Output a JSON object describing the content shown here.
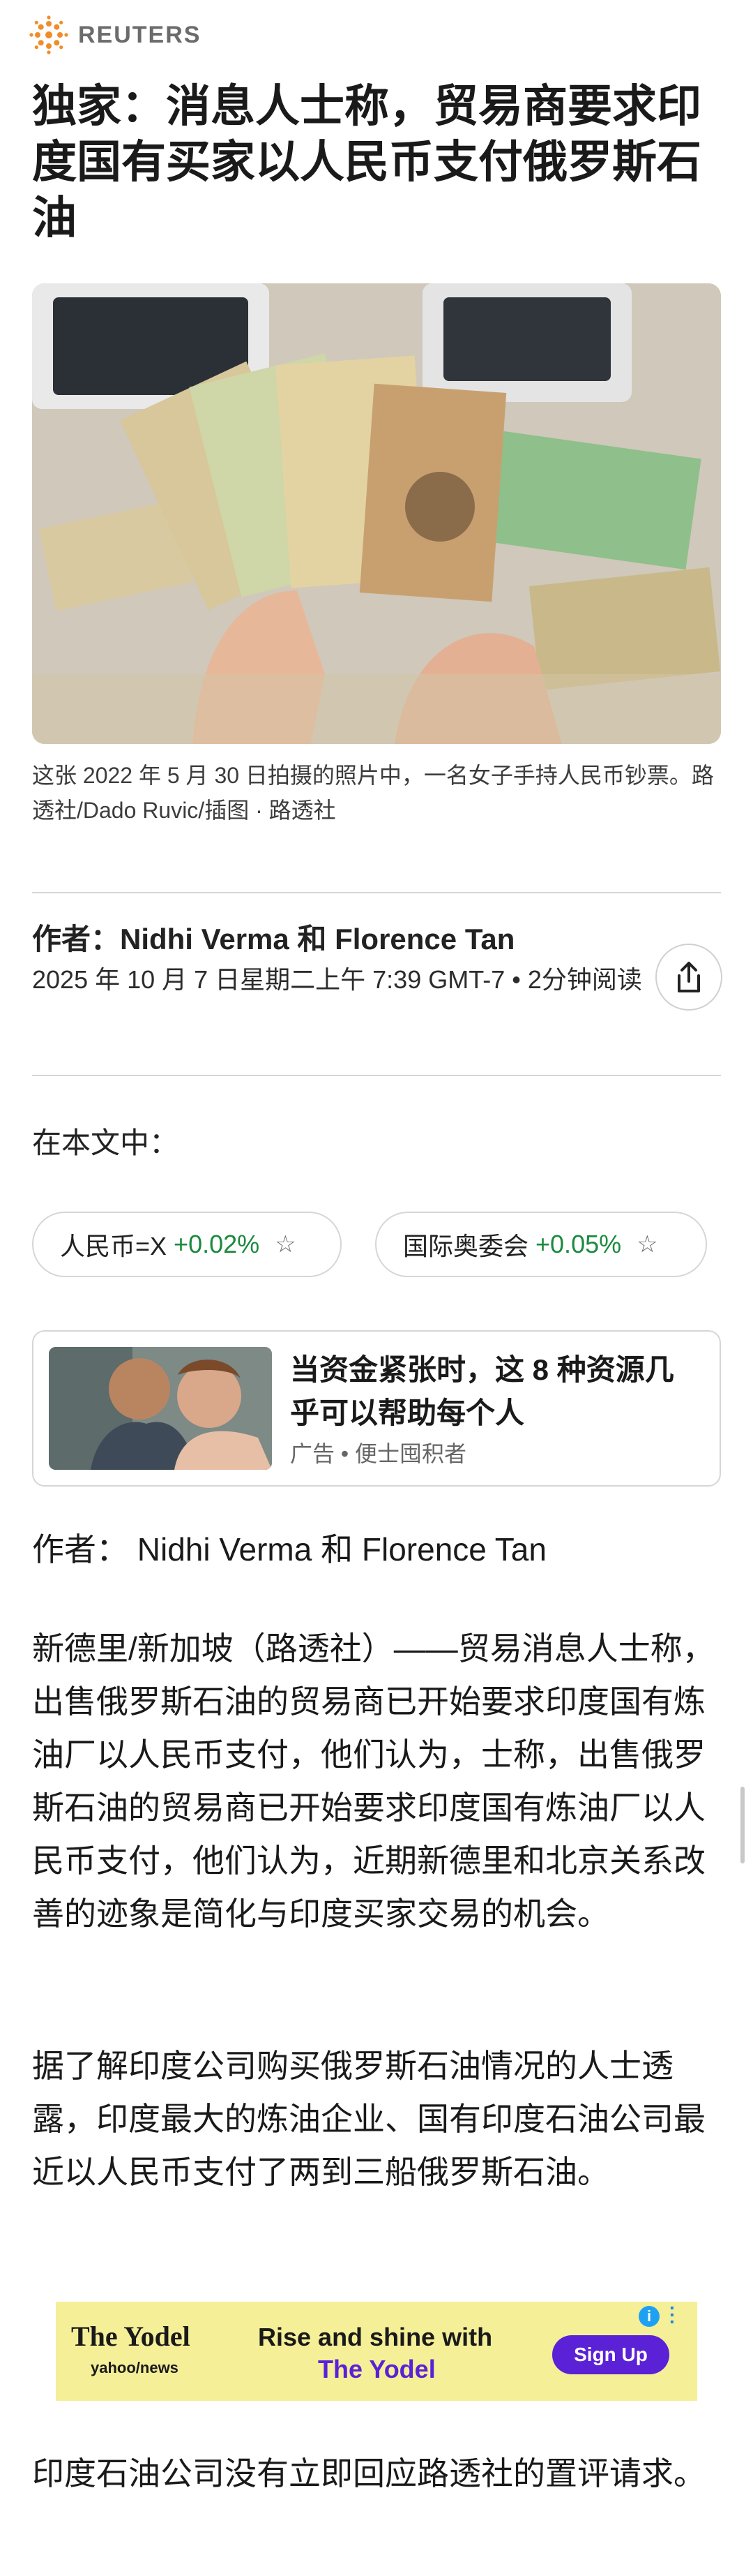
{
  "header": {
    "brand": "REUTERS"
  },
  "article": {
    "headline": "独家：消息人士称，贸易商要求印度国有买家以人民币支付俄罗斯石油",
    "caption": "这张 2022 年 5 月 30 日拍摄的照片中，一名女子手持人民币钞票。路透社/Dado Ruvic/插图 · 路透社",
    "byline": "作者：Nidhi Verma 和 Florence Tan",
    "date": "2025 年 10 月 7 日星期二上午 7:39 GMT-7 • 2分钟阅读",
    "in_this_article": "在本文中：",
    "paragraph_byline": "作者： Nidhi Verma 和 Florence Tan",
    "paragraph_1": "新德里/新加坡（路透社）——贸易消息人士称，出售俄罗斯石油的贸易商已开始要求印度国有炼油厂以人民币支付，他们认为，士称，出售俄罗斯石油的贸易商已开始要求印度国有炼油厂以人民币支付，他们认为，近期新德里和北京关系改善的迹象是简化与印度买家交易的机会。",
    "paragraph_2": "据了解印度公司购买俄罗斯石油情况的人士透露，印度最大的炼油企业、国有印度石油公司最近以人民币支付了两到三船俄罗斯石油。",
    "paragraph_3": "印度石油公司没有立即回应路透社的置评请求。"
  },
  "tickers": [
    {
      "name": "人民币=X",
      "change": "+0.02%",
      "icon": "star-outline-icon"
    },
    {
      "name": "国际奥委会",
      "change": "+0.05%",
      "icon": "star-outline-icon"
    }
  ],
  "sponsored": {
    "title": "当资金紧张时，这 8 种资源几乎可以帮助每个人",
    "meta": "广告 • 便士囤积者"
  },
  "banner_ad": {
    "logo": "The Yodel",
    "logo_sub": "yahoo/news",
    "tagline_1": "Rise and shine with",
    "tagline_2": "The Yodel",
    "cta": "Sign Up",
    "adchoice": "i"
  },
  "colors": {
    "positive": "#1b8a3e",
    "accent": "#5b21d6",
    "banner_bg": "#f5ef98"
  }
}
